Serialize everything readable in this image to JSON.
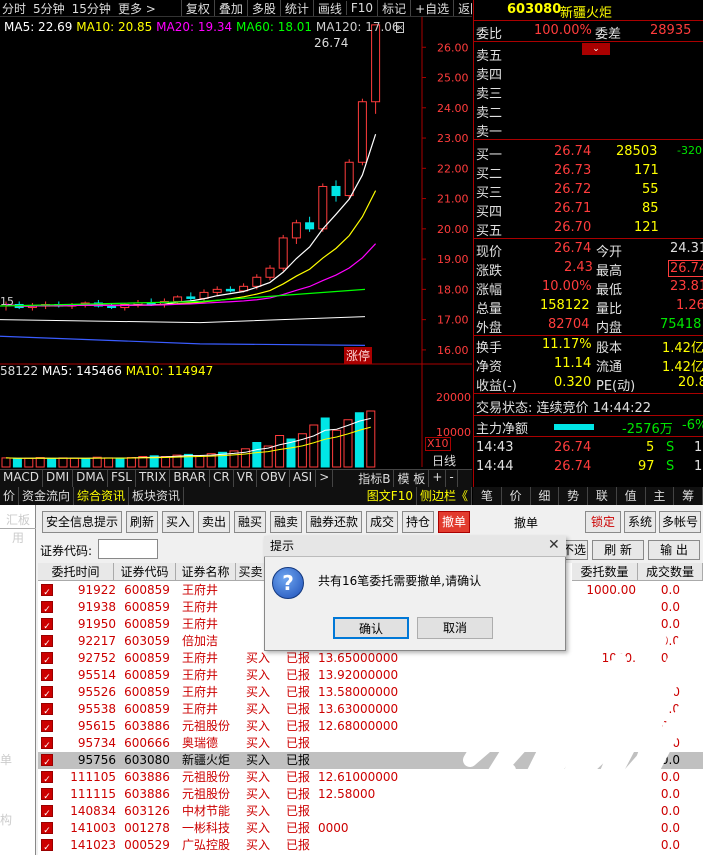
{
  "topbar": {
    "periods": [
      "分时",
      "5分钟",
      "15分钟",
      "更多 >"
    ],
    "tools": [
      "复权",
      "叠加",
      "多股",
      "统计",
      "画线",
      "F10",
      "标记",
      "+自选",
      "返回"
    ]
  },
  "chart_legend": {
    "ma5": "MA5: 22.69",
    "ma10": "MA10: 20.85",
    "ma20": "MA20: 19.34",
    "ma60": "MA60: 18.01",
    "ma120": "MA120: 17.06",
    "high_label": "26.74",
    "vol_ma5_prefix": "58122",
    "vol_ma5": "MA5: 145466",
    "vol_ma10": "MA10: 114947",
    "limit_up_tag": "涨停",
    "left_tick": "15",
    "vol_x10": "X10"
  },
  "colors": {
    "up": "#ff3c3c",
    "ma5": "#ffffff",
    "ma10": "#ffff00",
    "ma20": "#ff00ff",
    "ma60": "#00ff00",
    "ma120": "#00e0ff"
  },
  "chart_data": [
    {
      "type": "candlestick",
      "title": "",
      "yticks": [
        26.0,
        25.0,
        24.0,
        23.0,
        22.0,
        21.0,
        20.0,
        19.0,
        18.0,
        17.0,
        16.0
      ],
      "ylim": [
        15.6,
        27.0
      ],
      "high_marker": 26.74,
      "candles": [
        {
          "o": 17.45,
          "h": 17.6,
          "l": 17.3,
          "c": 17.5
        },
        {
          "o": 17.5,
          "h": 17.6,
          "l": 17.35,
          "c": 17.4
        },
        {
          "o": 17.4,
          "h": 17.55,
          "l": 17.3,
          "c": 17.45
        },
        {
          "o": 17.45,
          "h": 17.6,
          "l": 17.35,
          "c": 17.5
        },
        {
          "o": 17.5,
          "h": 17.6,
          "l": 17.4,
          "c": 17.45
        },
        {
          "o": 17.45,
          "h": 17.55,
          "l": 17.35,
          "c": 17.5
        },
        {
          "o": 17.5,
          "h": 17.6,
          "l": 17.4,
          "c": 17.55
        },
        {
          "o": 17.55,
          "h": 17.65,
          "l": 17.4,
          "c": 17.45
        },
        {
          "o": 17.45,
          "h": 17.55,
          "l": 17.35,
          "c": 17.4
        },
        {
          "o": 17.4,
          "h": 17.55,
          "l": 17.3,
          "c": 17.5
        },
        {
          "o": 17.5,
          "h": 17.65,
          "l": 17.4,
          "c": 17.55
        },
        {
          "o": 17.55,
          "h": 17.7,
          "l": 17.45,
          "c": 17.5
        },
        {
          "o": 17.5,
          "h": 17.7,
          "l": 17.4,
          "c": 17.6
        },
        {
          "o": 17.6,
          "h": 17.8,
          "l": 17.5,
          "c": 17.75
        },
        {
          "o": 17.75,
          "h": 17.9,
          "l": 17.6,
          "c": 17.7
        },
        {
          "o": 17.7,
          "h": 18.0,
          "l": 17.6,
          "c": 17.9
        },
        {
          "o": 17.9,
          "h": 18.1,
          "l": 17.8,
          "c": 18.0
        },
        {
          "o": 18.0,
          "h": 18.1,
          "l": 17.9,
          "c": 17.95
        },
        {
          "o": 17.95,
          "h": 18.2,
          "l": 17.9,
          "c": 18.1
        },
        {
          "o": 18.1,
          "h": 18.5,
          "l": 18.0,
          "c": 18.4
        },
        {
          "o": 18.4,
          "h": 18.8,
          "l": 18.3,
          "c": 18.7
        },
        {
          "o": 18.7,
          "h": 19.8,
          "l": 18.6,
          "c": 19.7
        },
        {
          "o": 19.7,
          "h": 20.3,
          "l": 19.5,
          "c": 20.2
        },
        {
          "o": 20.2,
          "h": 20.4,
          "l": 19.9,
          "c": 20.0
        },
        {
          "o": 20.0,
          "h": 21.5,
          "l": 19.9,
          "c": 21.4
        },
        {
          "o": 21.4,
          "h": 21.6,
          "l": 20.9,
          "c": 21.1
        },
        {
          "o": 21.1,
          "h": 22.3,
          "l": 21.0,
          "c": 22.2
        },
        {
          "o": 22.2,
          "h": 24.3,
          "l": 22.1,
          "c": 24.2
        },
        {
          "o": 24.2,
          "h": 26.74,
          "l": 23.8,
          "c": 26.74
        }
      ]
    },
    {
      "type": "bar",
      "title": "",
      "yticks": [
        20000,
        10000
      ],
      "ylim": [
        0,
        28000
      ],
      "values": [
        2600,
        2400,
        2500,
        2700,
        2300,
        2600,
        2500,
        2400,
        2800,
        2600,
        2500,
        2700,
        3000,
        3200,
        3000,
        3400,
        3600,
        3200,
        3800,
        4200,
        4600,
        5200,
        7000,
        6000,
        9000,
        8000,
        9500,
        12000,
        14000,
        10500,
        13500,
        15500,
        16000
      ]
    }
  ],
  "chart_tabs": [
    "MACD",
    "DMI",
    "DMA",
    "FSL",
    "TRIX",
    "BRAR",
    "CR",
    "VR",
    "OBV",
    "ASI",
    ">",
    "指标B",
    "模 板",
    "+",
    "-"
  ],
  "info_tabs": [
    "价",
    "资金流向",
    "综合资讯",
    "板块资讯"
  ],
  "info_right": [
    "图文F10",
    "侧边栏《"
  ],
  "day_line_label": "日线",
  "quote": {
    "code": "603080",
    "name": "新疆火炬",
    "wb_label": "委比",
    "wb_value": "100.00%",
    "wc_label": "委差",
    "wc_value": "28935",
    "sells": [
      "卖五",
      "卖四",
      "卖三",
      "卖二",
      "卖一"
    ],
    "buys": [
      {
        "label": "买一",
        "price": "26.74",
        "vol": "28503",
        "chg": "-320"
      },
      {
        "label": "买二",
        "price": "26.73",
        "vol": "171"
      },
      {
        "label": "买三",
        "price": "26.72",
        "vol": "55"
      },
      {
        "label": "买四",
        "price": "26.71",
        "vol": "85"
      },
      {
        "label": "买五",
        "price": "26.70",
        "vol": "121"
      }
    ],
    "stats": [
      {
        "l1": "现价",
        "v1": "26.74",
        "l2": "今开",
        "v2": "24.31"
      },
      {
        "l1": "涨跌",
        "v1": "2.43",
        "l2": "最高",
        "v2": "26.74"
      },
      {
        "l1": "涨幅",
        "v1": "10.00%",
        "l2": "最低",
        "v2": "23.81"
      },
      {
        "l1": "总量",
        "v1": "158122",
        "l2": "量比",
        "v2": "1.26"
      },
      {
        "l1": "外盘",
        "v1": "82704",
        "l2": "内盘",
        "v2": "75418"
      }
    ],
    "stats2": [
      {
        "l1": "换手",
        "v1": "11.17%",
        "l2": "股本",
        "v2": "1.42亿"
      },
      {
        "l1": "净资",
        "v1": "11.14",
        "l2": "流通",
        "v2": "1.42亿"
      },
      {
        "l1": "收益(-)",
        "v1": "0.320",
        "l2": "PE(动)",
        "v2": "20.8"
      }
    ],
    "trade_status": "交易状态: 连续竞价 14:44:22",
    "main_net_label": "主力净额",
    "main_net_value": "-2576万",
    "main_net_pct": "-6%",
    "ticks": [
      {
        "t": "14:43",
        "p": "26.74",
        "v": "5",
        "s": "S",
        "n": "1"
      },
      {
        "t": "14:44",
        "p": "26.74",
        "v": "97",
        "s": "S",
        "n": "1"
      }
    ]
  },
  "side_tabs": [
    "笔",
    "价",
    "细",
    "势",
    "联",
    "值",
    "主",
    "筹"
  ],
  "trade": {
    "leftnav": [
      "汇板",
      "用",
      "单",
      "构"
    ],
    "buttons": [
      "安全信息提示",
      "刷新",
      "买入",
      "卖出",
      "融买",
      "融卖",
      "融券还款",
      "成交",
      "持仓",
      "撤单"
    ],
    "cancel_title": "撤单",
    "right_buttons": [
      "锁定",
      "系统",
      "多帐号"
    ],
    "code_label": "证券代码:",
    "code_value": "",
    "btn_select": "不选",
    "btn_refresh": "刷 新",
    "btn_export": "输 出",
    "headers": [
      "委托时间",
      "证券代码",
      "证券名称",
      "买卖",
      "委托数量",
      "成交数量"
    ],
    "rows": [
      {
        "time": "91922",
        "code": "600859",
        "name": "王府井",
        "side": "",
        "status": "",
        "price": "",
        "qty": "1000.00",
        "done": "0.0"
      },
      {
        "time": "91938",
        "code": "600859",
        "name": "王府井",
        "side": "",
        "status": "",
        "price": "",
        "qty": "",
        "done": "0.0"
      },
      {
        "time": "91950",
        "code": "600859",
        "name": "王府井",
        "side": "",
        "status": "",
        "price": "",
        "qty": "",
        "done": "0.0"
      },
      {
        "time": "92217",
        "code": "603059",
        "name": "倍加洁",
        "side": "",
        "status": "",
        "price": "",
        "qty": "",
        "done": "0.0"
      },
      {
        "time": "92752",
        "code": "600859",
        "name": "王府井",
        "side": "买入",
        "status": "已报",
        "price": "13.65000000",
        "qty": "1000.",
        "done": "0.0"
      },
      {
        "time": "95514",
        "code": "600859",
        "name": "王府井",
        "side": "买入",
        "status": "已报",
        "price": "13.92000000",
        "qty": "",
        "done": "0.0"
      },
      {
        "time": "95526",
        "code": "600859",
        "name": "王府井",
        "side": "买入",
        "status": "已报",
        "price": "13.58000000",
        "qty": "",
        "done": "0.0"
      },
      {
        "time": "95538",
        "code": "600859",
        "name": "王府井",
        "side": "买入",
        "status": "已报",
        "price": "13.63000000",
        "qty": "",
        "done": "0.0"
      },
      {
        "time": "95615",
        "code": "603886",
        "name": "元祖股份",
        "side": "买入",
        "status": "已报",
        "price": "12.68000000",
        "qty": "",
        "done": "0.0"
      },
      {
        "time": "95734",
        "code": "600666",
        "name": "奥瑞德",
        "side": "买入",
        "status": "已报",
        "price": "",
        "qty": "",
        "done": "0.0"
      },
      {
        "time": "95756",
        "code": "603080",
        "name": "新疆火炬",
        "side": "买入",
        "status": "已报",
        "price": "",
        "qty": "",
        "done": "0.0"
      },
      {
        "time": "111105",
        "code": "603886",
        "name": "元祖股份",
        "side": "买入",
        "status": "已报",
        "price": "12.61000000",
        "qty": "",
        "done": "0.0"
      },
      {
        "time": "111115",
        "code": "603886",
        "name": "元祖股份",
        "side": "买入",
        "status": "已报",
        "price": "12.58000",
        "qty": "",
        "done": "0.0"
      },
      {
        "time": "140834",
        "code": "603126",
        "name": "中材节能",
        "side": "买入",
        "status": "已报",
        "price": "",
        "qty": "",
        "done": "0.0"
      },
      {
        "time": "141003",
        "code": "001278",
        "name": "一彬科技",
        "side": "买入",
        "status": "已报",
        "price": "0000",
        "qty": "",
        "done": "0.0"
      },
      {
        "time": "141023",
        "code": "000529",
        "name": "广弘控股",
        "side": "买入",
        "status": "已报",
        "price": "",
        "qty": "",
        "done": "0.0"
      }
    ]
  },
  "dialog": {
    "title": "提示",
    "icon": "question-icon",
    "message": "共有16笔委托需要撤单,请确认",
    "ok": "确认",
    "cancel": "取消"
  }
}
